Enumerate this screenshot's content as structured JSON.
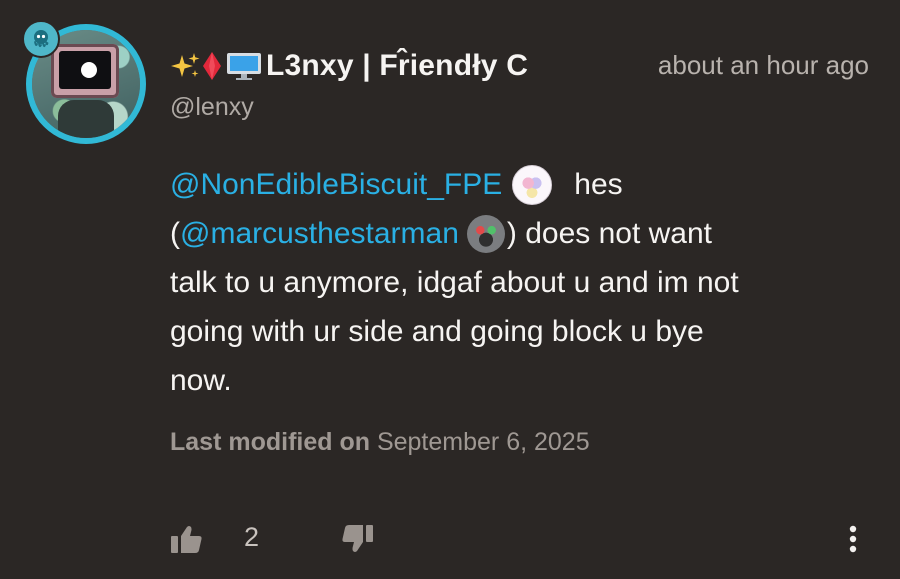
{
  "post": {
    "author": {
      "display_name": "L3nxy | Fr̂iendły C",
      "handle": "@lenxy",
      "avatar_icon": "monitor-character-avatar",
      "badge_icon": "octopus-badge-icon",
      "name_icons": [
        "sparkles-icon",
        "red-diamond-icon",
        "computer-monitor-icon"
      ]
    },
    "timestamp": "about an hour ago",
    "message": {
      "mention_1": "@NonEdibleBiscuit_FPE",
      "text_1": "hes",
      "open_paren": "(",
      "mention_2": "@marcusthestarman",
      "text_2": ") does not want",
      "line_3": "talk to u anymore, idgaf about u and im not",
      "line_4": "going with ur side and going block u bye",
      "line_5": "now."
    },
    "modified": {
      "label": "Last modified on",
      "date": "September 6, 2025"
    },
    "actions": {
      "like_count": "2",
      "like_icon": "thumbs-up-icon",
      "dislike_icon": "thumbs-down-icon",
      "more_icon": "more-vertical-icon"
    }
  },
  "colors": {
    "background": "#2b2725",
    "mention": "#2ab0e4",
    "avatar_ring": "#31b9d6",
    "text_primary": "#f6f4f2",
    "text_secondary": "#b8b2ad"
  }
}
